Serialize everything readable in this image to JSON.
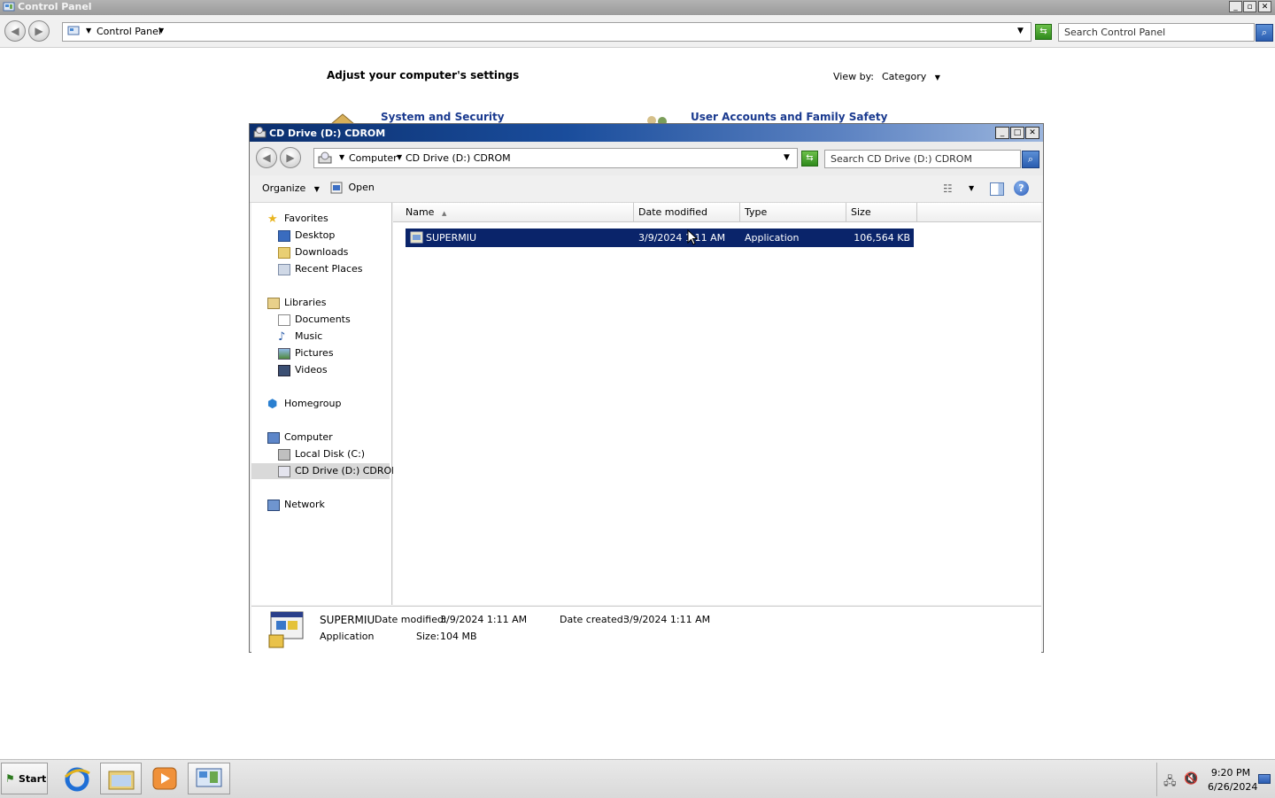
{
  "control_panel": {
    "title": "Control Panel",
    "breadcrumb": "Control Panel",
    "search_placeholder": "Search Control Panel",
    "heading": "Adjust your computer's settings",
    "view_by_label": "View by:",
    "view_by_value": "Category",
    "categories": [
      "System and Security",
      "User Accounts and Family Safety"
    ]
  },
  "cd_window": {
    "title": "CD Drive (D:) CDROM",
    "breadcrumb": [
      "Computer",
      "CD Drive (D:) CDROM"
    ],
    "search_placeholder": "Search CD Drive (D:) CDROM",
    "toolbar": {
      "organize": "Organize",
      "open": "Open"
    },
    "nav": {
      "favorites": {
        "label": "Favorites",
        "items": [
          "Desktop",
          "Downloads",
          "Recent Places"
        ]
      },
      "libraries": {
        "label": "Libraries",
        "items": [
          "Documents",
          "Music",
          "Pictures",
          "Videos"
        ]
      },
      "homegroup": "Homegroup",
      "computer": {
        "label": "Computer",
        "items": [
          "Local Disk (C:)",
          "CD Drive (D:) CDROM"
        ]
      },
      "network": "Network"
    },
    "columns": [
      "Name",
      "Date modified",
      "Type",
      "Size"
    ],
    "files": [
      {
        "name": "SUPERMIU",
        "date_modified": "3/9/2024 1:11 AM",
        "type": "Application",
        "size": "106,564 KB"
      }
    ],
    "details": {
      "name": "SUPERMIU",
      "type": "Application",
      "date_modified_label": "Date modified:",
      "date_modified": "3/9/2024 1:11 AM",
      "date_created_label": "Date created:",
      "date_created": "3/9/2024 1:11 AM",
      "size_label": "Size:",
      "size": "104 MB"
    }
  },
  "taskbar": {
    "start": "Start",
    "time": "9:20 PM",
    "date": "6/26/2024"
  },
  "colors": {
    "selection": "#0a246a",
    "titlebar": "#1a4d9c",
    "link": "#1a3a8f"
  }
}
